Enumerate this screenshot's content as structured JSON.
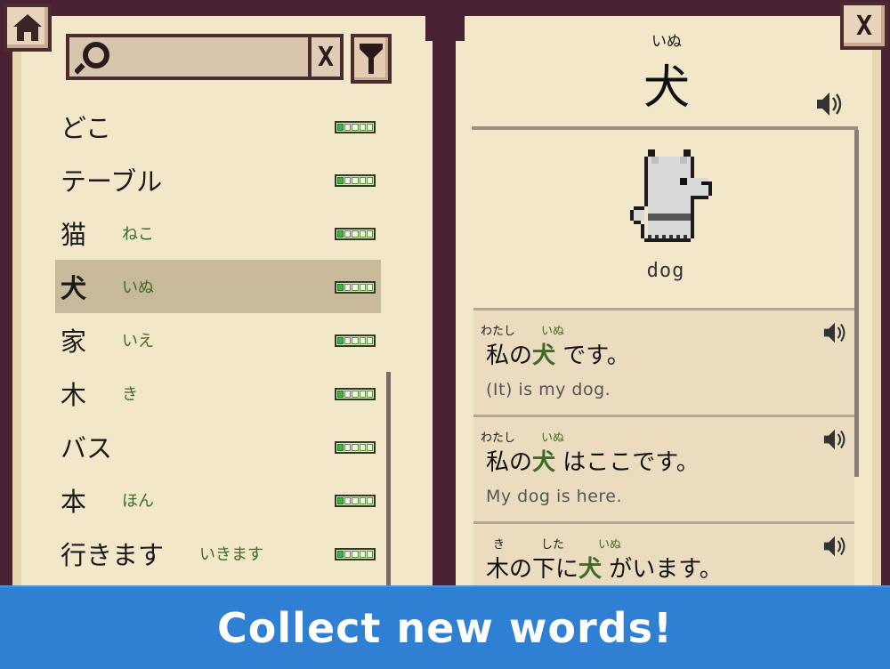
{
  "search": {
    "placeholder": "",
    "clear_label": "X"
  },
  "close_label": "X",
  "words": [
    {
      "kanji": "どこ",
      "reading": "",
      "selected": false
    },
    {
      "kanji": "テーブル",
      "reading": "",
      "selected": false
    },
    {
      "kanji": "猫",
      "reading": "ねこ",
      "selected": false
    },
    {
      "kanji": "犬",
      "reading": "いぬ",
      "selected": true
    },
    {
      "kanji": "家",
      "reading": "いえ",
      "selected": false
    },
    {
      "kanji": "木",
      "reading": "き",
      "selected": false
    },
    {
      "kanji": "バス",
      "reading": "",
      "selected": false
    },
    {
      "kanji": "本",
      "reading": "ほん",
      "selected": false
    },
    {
      "kanji": "行きます",
      "reading": "いきます",
      "selected": false
    }
  ],
  "detail": {
    "furigana": "いぬ",
    "kanji": "犬",
    "meaning": "dog"
  },
  "examples": [
    {
      "furi_1": "わたし",
      "furi_2": "いぬ",
      "part_a": "私の",
      "highlight": "犬",
      "part_b": " です。",
      "english": "(It) is my dog."
    },
    {
      "furi_1": "わたし",
      "furi_2": "いぬ",
      "part_a": "私の",
      "highlight": "犬",
      "part_b": " はここです。",
      "english": "My dog is here."
    },
    {
      "furi_1": "き",
      "furi_mid": "した",
      "furi_2": "いぬ",
      "part_a": "木の下に",
      "highlight": "犬",
      "part_b": " がいます。",
      "english": ""
    }
  ],
  "banner": {
    "text": "Collect new words!"
  },
  "colors": {
    "accent_green": "#3f6b2a",
    "banner_blue": "#2f7fd2",
    "progress_green": "#36b93a"
  },
  "icons": [
    "home-icon",
    "search-icon",
    "filter-icon",
    "speaker-icon",
    "dog-image"
  ]
}
